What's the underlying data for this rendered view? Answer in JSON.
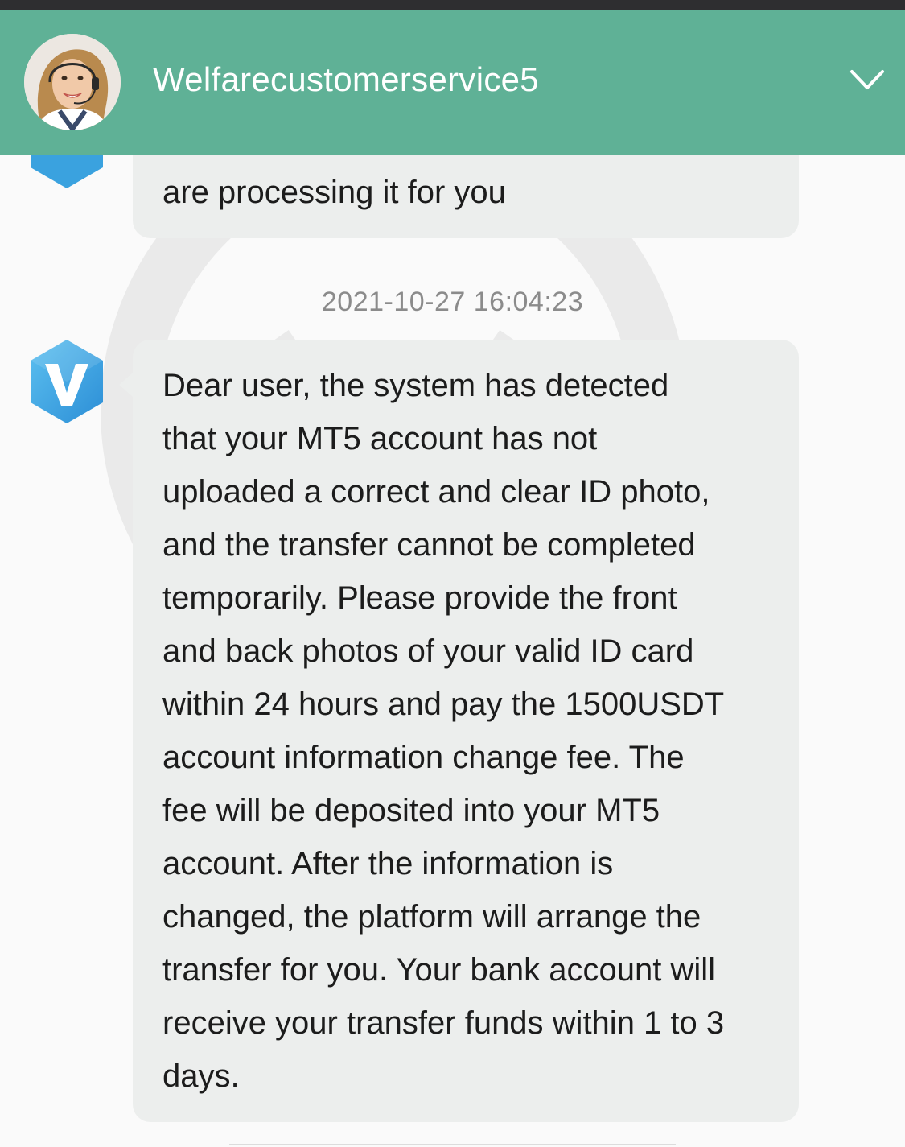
{
  "header": {
    "title": "Welfarecustomerservice5",
    "avatar_icon": "customer-service-agent-avatar",
    "collapse_icon": "chevron-down-icon",
    "background_color": "#5fb196"
  },
  "messages": [
    {
      "sender_icon": "v-hexagon-logo-icon",
      "text": "are processing it for you"
    },
    {
      "timestamp": "2021-10-27 16:04:23",
      "sender_icon": "v-hexagon-logo-icon",
      "lines": [
        "Dear user, the system has detected",
        "that your MT5 account has not",
        "uploaded a correct and clear ID photo,",
        "and the transfer cannot be completed",
        "temporarily. Please provide the front",
        "and back photos of your valid ID card",
        "within 24 hours and pay the 1500USDT",
        "account information change fee. The",
        "fee will be deposited into your MT5",
        "account. After the information is",
        "changed, the platform will arrange the",
        "transfer for you. Your bank account will",
        "receive your transfer funds within 1 to 3",
        "days."
      ]
    }
  ],
  "colors": {
    "bubble": "#eceeed",
    "logo_blue": "#3aa2df",
    "page_background": "#fafafa"
  }
}
